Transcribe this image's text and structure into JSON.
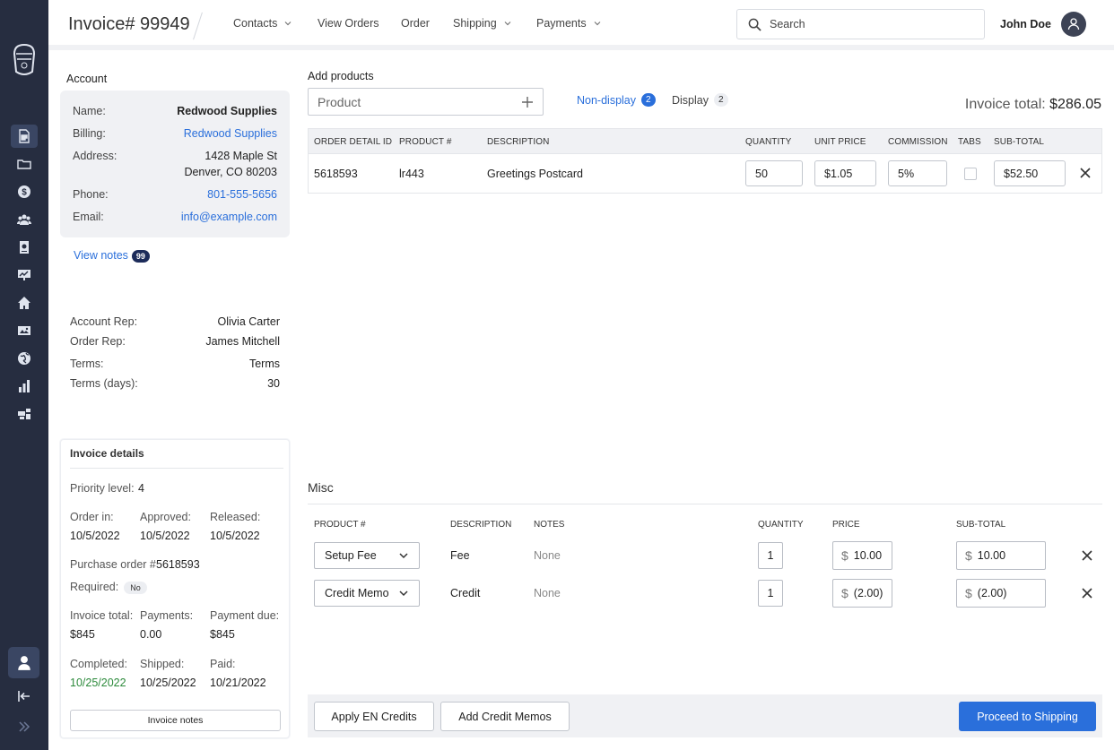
{
  "header": {
    "title": "Invoice# 99949",
    "nav": [
      {
        "label": "Contacts"
      },
      {
        "label": "View Orders"
      },
      {
        "label": "Order"
      },
      {
        "label": "Shipping"
      },
      {
        "label": "Payments"
      }
    ],
    "search_placeholder": "Search",
    "user_name": "John Doe"
  },
  "sidebar": {
    "icons": [
      "document-icon",
      "folder-icon",
      "dollar-icon",
      "users-icon",
      "report-icon",
      "presentation-icon",
      "home-icon",
      "image-icon",
      "globe-icon",
      "bar-chart-icon",
      "tools-icon"
    ],
    "bottom": [
      "user-icon",
      "collapse-icon",
      "expand-icon"
    ]
  },
  "account": {
    "heading": "Account",
    "name_label": "Name:",
    "name": "Redwood Supplies",
    "billing_label": "Billing:",
    "billing": "Redwood Supplies",
    "address_label": "Address:",
    "address_line1": "1428 Maple St",
    "address_line2": "Denver, CO 80203",
    "phone_label": "Phone:",
    "phone": "801-555-5656",
    "email_label": "Email:",
    "email": "info@example.com",
    "view_notes": "View notes",
    "notes_count": "99"
  },
  "reps": {
    "account_rep_label": "Account Rep:",
    "account_rep": "Olivia Carter",
    "order_rep_label": "Order Rep:",
    "order_rep": "James Mitchell",
    "terms_label": "Terms:",
    "terms": "Terms",
    "terms_days_label": "Terms (days):",
    "terms_days": "30"
  },
  "invoice_details": {
    "title": "Invoice details",
    "priority_label": "Priority level:",
    "priority": "4",
    "order_in_label": "Order in:",
    "order_in": "10/5/2022",
    "approved_label": "Approved:",
    "approved": "10/5/2022",
    "released_label": "Released:",
    "released": "10/5/2022",
    "po_label": "Purchase order #",
    "po": "5618593",
    "required_label": "Required:",
    "required": "No",
    "invoice_total_label": "Invoice total:",
    "invoice_total": "$845",
    "payments_label": "Payments:",
    "payments": "0.00",
    "payment_due_label": "Payment due:",
    "payment_due": "$845",
    "completed_label": "Completed:",
    "completed": "10/25/2022",
    "shipped_label": "Shipped:",
    "shipped": "10/25/2022",
    "paid_label": "Paid:",
    "paid": "10/21/2022",
    "notes_button": "Invoice notes"
  },
  "products": {
    "heading": "Add products",
    "product_placeholder": "Product",
    "tabs": [
      {
        "label": "Non-display",
        "count": "2"
      },
      {
        "label": "Display",
        "count": "2"
      }
    ],
    "invoice_total_label": "Invoice total:",
    "invoice_total": "$286.05",
    "columns": [
      "ORDER DETAIL ID",
      "PRODUCT #",
      "DESCRIPTION",
      "QUANTITY",
      "UNIT PRICE",
      "COMMISSION",
      "TABS",
      "SUB-TOTAL"
    ],
    "rows": [
      {
        "detail_id": "5618593",
        "product": "lr443",
        "description": "Greetings Postcard",
        "quantity": "50",
        "unit_price": "$1.05",
        "commission": "5%",
        "subtotal": "$52.50"
      }
    ]
  },
  "misc": {
    "title": "Misc",
    "columns": [
      "PRODUCT #",
      "DESCRIPTION",
      "NOTES",
      "QUANTITY",
      "PRICE",
      "SUB-TOTAL"
    ],
    "currency": "$",
    "rows": [
      {
        "product": "Setup Fee",
        "description": "Fee",
        "notes": "None",
        "quantity": "1",
        "price": "10.00",
        "subtotal": "10.00"
      },
      {
        "product": "Credit Memo",
        "description": "Credit",
        "notes": "None",
        "quantity": "1",
        "price": "(2.00)",
        "subtotal": "(2.00)"
      }
    ]
  },
  "footer": {
    "apply_credits": "Apply EN Credits",
    "add_memos": "Add Credit Memos",
    "proceed": "Proceed to Shipping"
  },
  "colors": {
    "sidebar": "#262d40",
    "accent": "#2a6fdb",
    "success": "#2c8a3b"
  }
}
